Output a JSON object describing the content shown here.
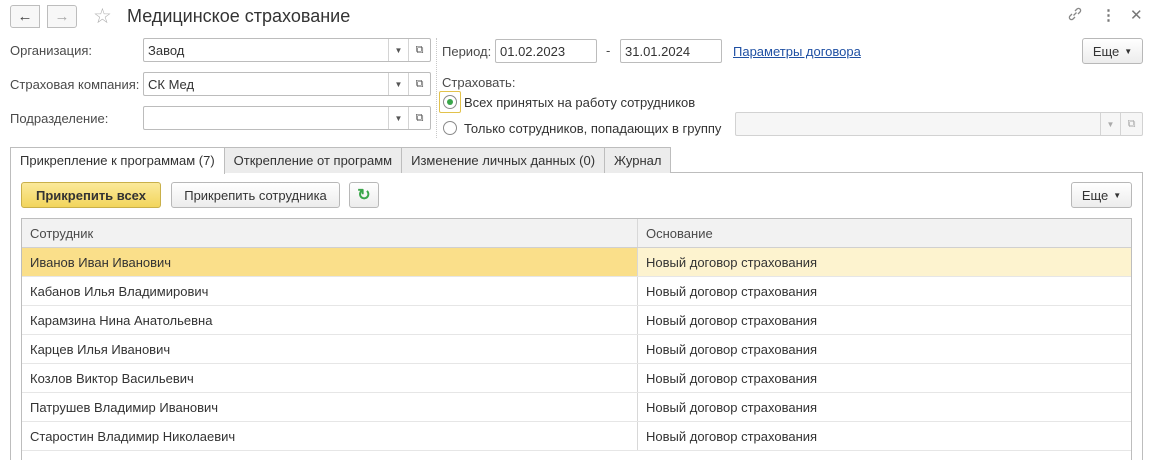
{
  "window": {
    "title": "Медицинское страхование",
    "back_icon": "←",
    "forward_icon": "→"
  },
  "form": {
    "organization": {
      "label": "Организация:",
      "value": "Завод"
    },
    "insurance_company": {
      "label": "Страховая компания:",
      "value": "СК Мед"
    },
    "department": {
      "label": "Подразделение:",
      "value": ""
    },
    "period": {
      "label": "Период:",
      "from": "01.02.2023",
      "separator": "-",
      "to": "31.01.2024"
    },
    "contract_params_link": "Параметры договора",
    "more_button": "Еще",
    "insure": {
      "label": "Страховать:",
      "options": [
        {
          "label": "Всех принятых на работу сотрудников",
          "checked": true
        },
        {
          "label": "Только сотрудников, попадающих в группу",
          "checked": false
        }
      ],
      "group_value": ""
    }
  },
  "tabs": [
    {
      "label": "Прикрепление к программам (7)",
      "active": true
    },
    {
      "label": "Открепление от программ",
      "active": false
    },
    {
      "label": "Изменение личных данных (0)",
      "active": false
    },
    {
      "label": "Журнал",
      "active": false
    }
  ],
  "toolbar": {
    "attach_all": "Прикрепить всех",
    "attach_employee": "Прикрепить сотрудника",
    "refresh_icon": "↻",
    "more": "Еще"
  },
  "table": {
    "columns": [
      "Сотрудник",
      "Основание"
    ],
    "rows": [
      {
        "employee": "Иванов Иван Иванович",
        "basis": "Новый договор страхования",
        "selected": true
      },
      {
        "employee": "Кабанов Илья Владимирович",
        "basis": "Новый договор страхования"
      },
      {
        "employee": "Карамзина Нина Анатольевна",
        "basis": "Новый договор страхования"
      },
      {
        "employee": "Карцев Илья Иванович",
        "basis": "Новый договор страхования"
      },
      {
        "employee": "Козлов Виктор Васильевич",
        "basis": "Новый договор страхования"
      },
      {
        "employee": "Патрушев Владимир Иванович",
        "basis": "Новый договор страхования"
      },
      {
        "employee": "Старостин Владимир Николаевич",
        "basis": "Новый договор страхования"
      }
    ]
  },
  "colors": {
    "accent_yellow": "#f2d55c",
    "selected_row": "#fadf8a",
    "link": "#1f50a3",
    "radio_check": "#3aa64a"
  }
}
